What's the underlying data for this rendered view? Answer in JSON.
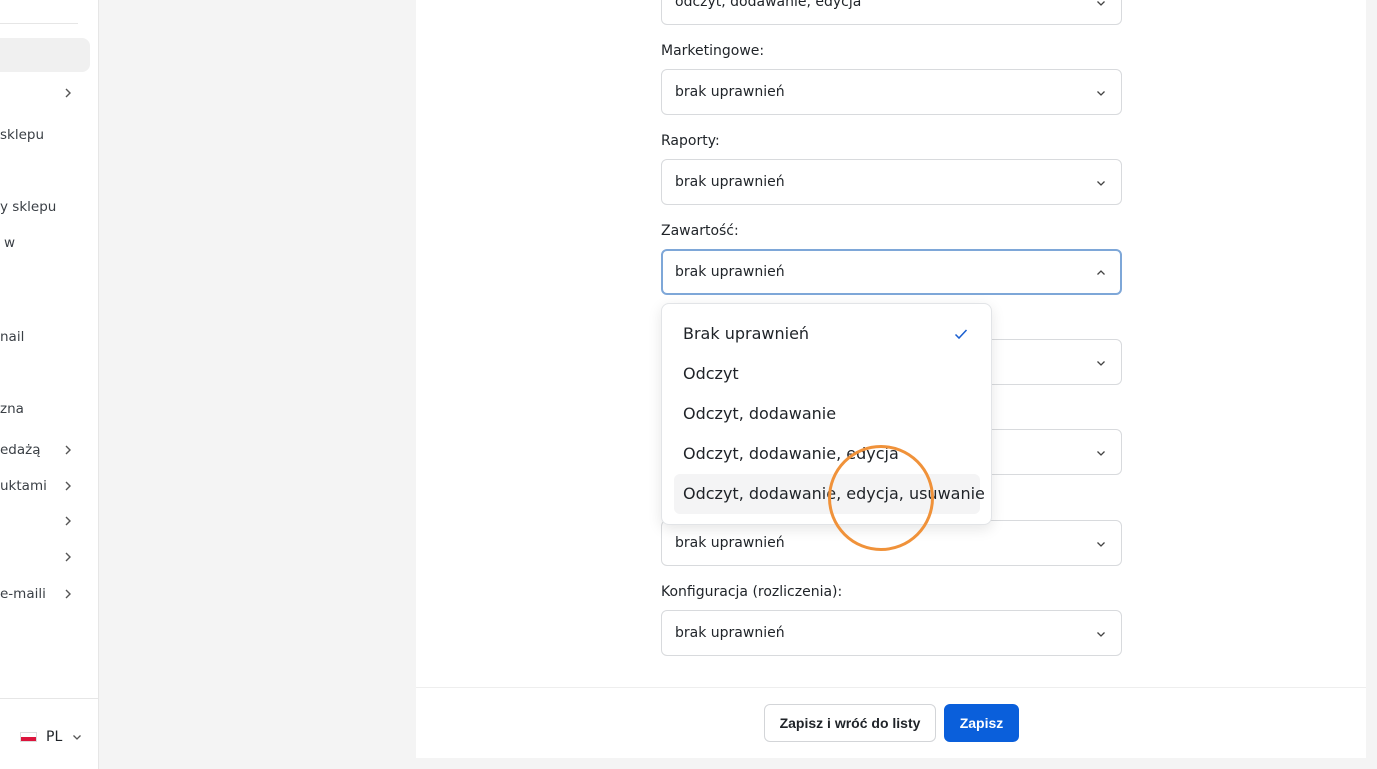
{
  "sidebar": {
    "items": [
      {
        "label": "",
        "has_chevron": true
      },
      {
        "label": "sklepu",
        "has_chevron": false
      },
      {
        "label": "y sklepu",
        "has_chevron": false
      },
      {
        "label": "w",
        "has_chevron": false
      },
      {
        "label": "nail",
        "has_chevron": false
      },
      {
        "label": "zna",
        "has_chevron": false
      },
      {
        "label": "edażą",
        "has_chevron": true
      },
      {
        "label": "uktami",
        "has_chevron": true
      },
      {
        "label": "",
        "has_chevron": true
      },
      {
        "label": "",
        "has_chevron": true
      },
      {
        "label": "e-maili",
        "has_chevron": true
      }
    ],
    "language": {
      "code": "PL",
      "icon": "poland-flag-icon"
    }
  },
  "form": {
    "top_partial_value": "odczyt, dodawanie, edycja",
    "fields": [
      {
        "label": "Marketingowe:",
        "value": "brak uprawnień"
      },
      {
        "label": "Raporty:",
        "value": "brak uprawnień"
      },
      {
        "label": "Zawartość:",
        "value": "brak uprawnień"
      }
    ],
    "hidden_fields": [
      {
        "value": ""
      },
      {
        "value": ""
      }
    ],
    "after_fields": [
      {
        "label": "",
        "value": "brak uprawnień"
      },
      {
        "label": "Konfiguracja (rozliczenia):",
        "value": "brak uprawnień"
      }
    ]
  },
  "dropdown": {
    "options": [
      {
        "label": "Brak uprawnień",
        "selected": true
      },
      {
        "label": "Odczyt",
        "selected": false
      },
      {
        "label": "Odczyt, dodawanie",
        "selected": false
      },
      {
        "label": "Odczyt, dodawanie, edycja",
        "selected": false
      },
      {
        "label": "Odczyt, dodawanie, edycja, usuwanie",
        "selected": false,
        "hovered": true
      }
    ]
  },
  "footer": {
    "save_and_back_label": "Zapisz i wróć do listy",
    "save_label": "Zapisz"
  },
  "colors": {
    "primary": "#0a5fdb",
    "focus_border": "#7ea7d8",
    "highlight_ring": "#f0923a"
  }
}
